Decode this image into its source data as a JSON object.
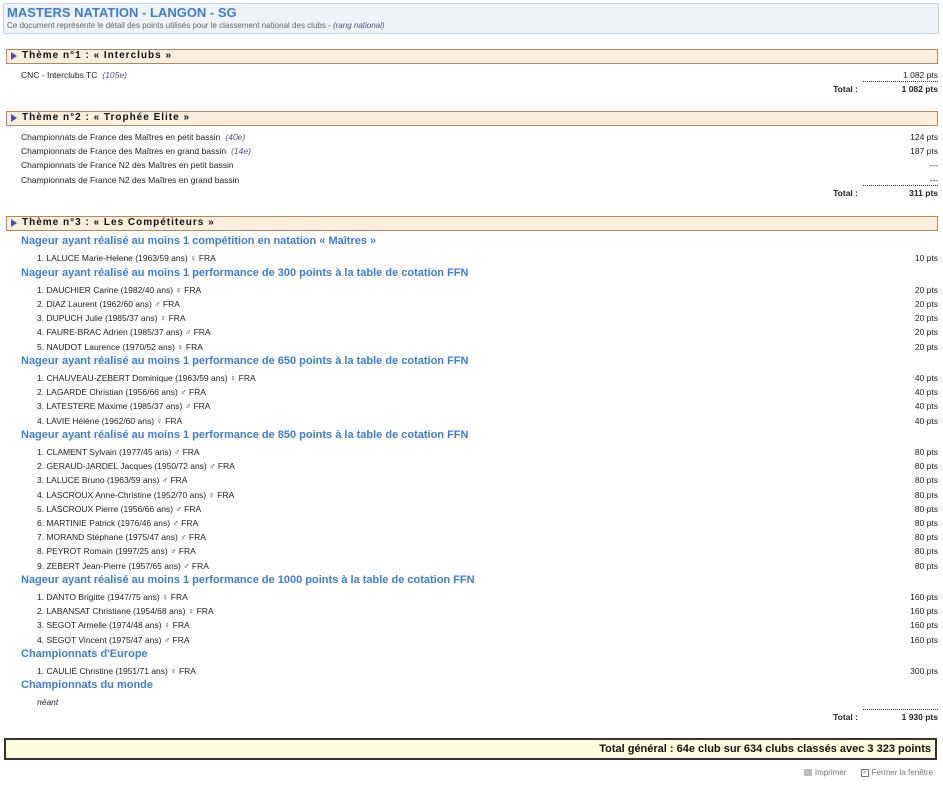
{
  "header": {
    "title": "MASTERS NATATION - LANGON - SG",
    "subtitle": "Ce document représente le détail des points utilisés pour le classement national des clubs - ",
    "subtitle_note": "(rang national)"
  },
  "themes": [
    {
      "label": "Thème n°1 : « Interclubs »",
      "rows": [
        {
          "name": "CNC - Interclubs TC",
          "rank": "(105e)",
          "points": "1 082 pts"
        }
      ],
      "total_label": "Total :",
      "total": "1 082 pts"
    },
    {
      "label": "Thème n°2 : « Trophée Elite »",
      "rows": [
        {
          "name": "Championnats de France des Maîtres en petit bassin",
          "rank": "(40e)",
          "points": "124 pts"
        },
        {
          "name": "Championnats de France des Maîtres en grand bassin",
          "rank": "(14e)",
          "points": "187 pts"
        },
        {
          "name": "Championnats de France N2 des Maîtres en petit bassin",
          "rank": "",
          "points": "---"
        },
        {
          "name": "Championnats de France N2 des Maîtres en grand bassin",
          "rank": "",
          "points": "---"
        }
      ],
      "total_label": "Total :",
      "total": "311 pts"
    },
    {
      "label": "Thème n°3 : « Les Compétiteurs »",
      "total_label": "Total :",
      "total": "1 930 pts"
    }
  ],
  "competiteurs": [
    {
      "title": "Nageur ayant réalisé au moins 1 compétition en natation « Maîtres »",
      "swimmers": [
        {
          "name": "1. LALUCE Marie-Helene (1963/59 ans) ♀ FRA",
          "points": "10 pts"
        }
      ]
    },
    {
      "title": "Nageur ayant réalisé au moins 1 performance de 300 points à la table de cotation FFN",
      "swimmers": [
        {
          "name": "1. DAUCHIER Carine (1982/40 ans) ♀ FRA",
          "points": "20 pts"
        },
        {
          "name": "2. DIAZ Laurent (1962/60 ans) ♂ FRA",
          "points": "20 pts"
        },
        {
          "name": "3. DUPUCH Julie (1985/37 ans) ♀ FRA",
          "points": "20 pts"
        },
        {
          "name": "4. FAURE-BRAC Adrien (1985/37 ans) ♂ FRA",
          "points": "20 pts"
        },
        {
          "name": "5. NAUDOT Laurence (1970/52 ans) ♀ FRA",
          "points": "20 pts"
        }
      ]
    },
    {
      "title": "Nageur ayant réalisé au moins 1 performance de 650 points à la table de cotation FFN",
      "swimmers": [
        {
          "name": "1. CHAUVEAU-ZEBERT Dominique (1963/59 ans) ♀ FRA",
          "points": "40 pts"
        },
        {
          "name": "2. LAGARDE Christian (1956/66 ans) ♂ FRA",
          "points": "40 pts"
        },
        {
          "name": "3. LATESTERE Maxime (1985/37 ans) ♂ FRA",
          "points": "40 pts"
        },
        {
          "name": "4. LAVIE Hélène (1962/60 ans) ♀ FRA",
          "points": "40 pts"
        }
      ]
    },
    {
      "title": "Nageur ayant réalisé au moins 1 performance de 850 points à la table de cotation FFN",
      "swimmers": [
        {
          "name": "1. CLAMENT Sylvain (1977/45 ans) ♂ FRA",
          "points": "80 pts"
        },
        {
          "name": "2. GERAUD-JARDEL Jacques (1950/72 ans) ♂ FRA",
          "points": "80 pts"
        },
        {
          "name": "3. LALUCE Bruno (1963/59 ans) ♂ FRA",
          "points": "80 pts"
        },
        {
          "name": "4. LASCROUX Anne-Christine (1952/70 ans) ♀ FRA",
          "points": "80 pts"
        },
        {
          "name": "5. LASCROUX Pierre (1956/66 ans) ♂ FRA",
          "points": "80 pts"
        },
        {
          "name": "6. MARTINIE Patrick (1976/46 ans) ♂ FRA",
          "points": "80 pts"
        },
        {
          "name": "7. MORAND Stéphane (1975/47 ans) ♂ FRA",
          "points": "80 pts"
        },
        {
          "name": "8. PEYROT Romain (1997/25 ans) ♂ FRA",
          "points": "80 pts"
        },
        {
          "name": "9. ZEBERT Jean-Pierre (1957/65 ans) ♂ FRA",
          "points": "80 pts"
        }
      ]
    },
    {
      "title": "Nageur ayant réalisé au moins 1 performance de 1000 points à la table de cotation FFN",
      "swimmers": [
        {
          "name": "1. DANTO Brigitte (1947/75 ans) ♀ FRA",
          "points": "160 pts"
        },
        {
          "name": "2. LABANSAT Christiane (1954/68 ans) ♀ FRA",
          "points": "160 pts"
        },
        {
          "name": "3. SEGOT Armelle (1974/48 ans) ♀ FRA",
          "points": "160 pts"
        },
        {
          "name": "4. SEGOT Vincent (1975/47 ans) ♂ FRA",
          "points": "160 pts"
        }
      ]
    },
    {
      "title": "Championnats d'Europe",
      "swimmers": [
        {
          "name": "1. CAULIÉ Christine (1951/71 ans) ♀ FRA",
          "points": "300 pts"
        }
      ]
    },
    {
      "title": "Championnats du monde",
      "swimmers": [],
      "empty_text": "néant"
    }
  ],
  "grand_total": "Total général : 64e club sur 634 clubs classés avec 3 323 points",
  "actions": {
    "print": "Imprimer",
    "close": "Fermer la fenêtre"
  }
}
